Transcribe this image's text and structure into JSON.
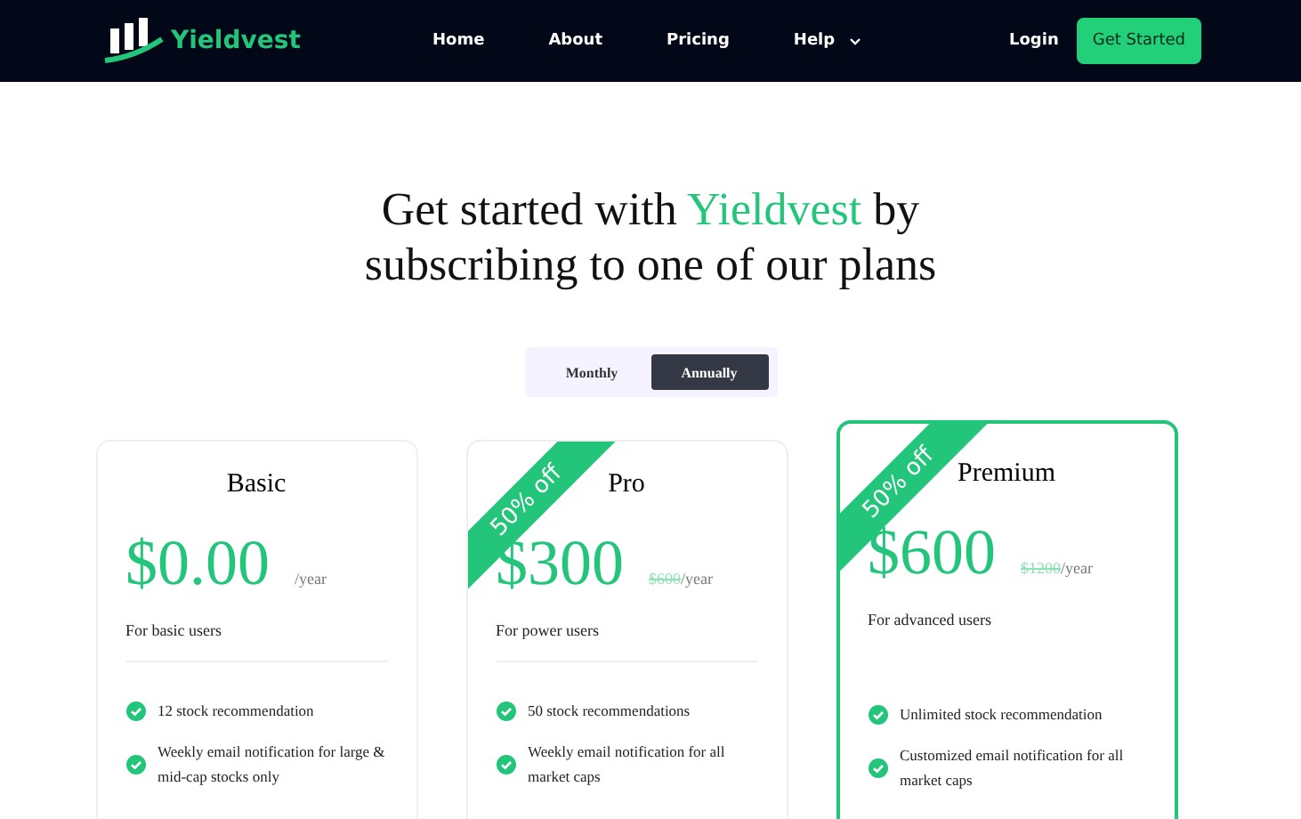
{
  "navbar": {
    "brand": "Yieldvest",
    "links": [
      {
        "label": "Home",
        "dropdown": false
      },
      {
        "label": "About",
        "dropdown": false
      },
      {
        "label": "Pricing",
        "dropdown": false
      },
      {
        "label": "Help",
        "dropdown": true
      }
    ],
    "login": "Login",
    "cta": "Get Started"
  },
  "heading": {
    "before": "Get started with",
    "brand": "Yieldvest",
    "after": "by subscribing to one of our plans"
  },
  "billing_toggle": [
    {
      "label": "Monthly",
      "selected": false
    },
    {
      "label": "Annually",
      "selected": true
    }
  ],
  "plans": [
    {
      "name": "Basic",
      "price": "$0.00",
      "period": "/year",
      "audience": "For basic users",
      "highlighted": false,
      "features": [
        "12 stock recommendation",
        "Weekly email notification for large & mid-cap stocks only"
      ]
    },
    {
      "name": "Pro",
      "price": "$300",
      "original_price": "$600",
      "period": "/year",
      "audience": "For power users",
      "highlighted": false,
      "ribbon": "50% off",
      "features": [
        "50 stock recommendations",
        "Weekly email notification for all market caps"
      ]
    },
    {
      "name": "Premium",
      "price": "$600",
      "original_price": "$1200",
      "period": "/year",
      "audience": "For advanced users",
      "highlighted": true,
      "ribbon": "50% off",
      "features": [
        "Unlimited stock recommendation",
        "Customized email notification for all market caps"
      ]
    }
  ]
}
